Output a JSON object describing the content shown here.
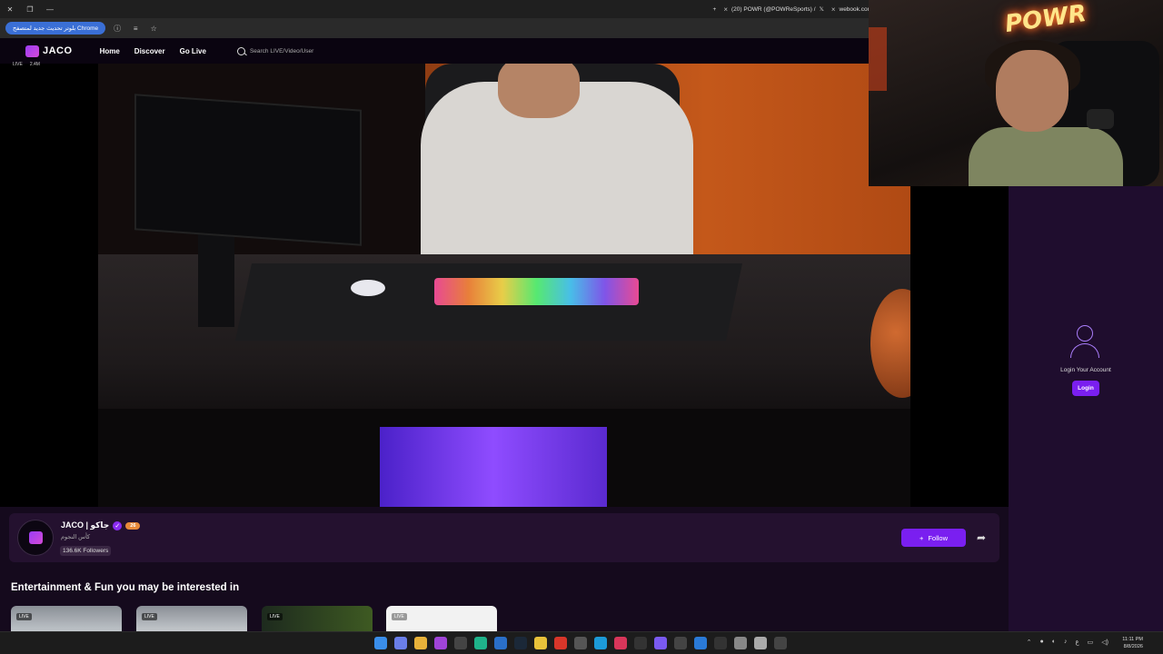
{
  "browser": {
    "update_pill": "بلوتر تحديث جديد لمتصفح Chrome",
    "tabs": [
      {
        "title": "(20) POWR (@POWReSports) /"
      },
      {
        "title": "webook.com"
      }
    ],
    "new_tab_label": "+",
    "close_label": "×",
    "x_logo": "𝕏"
  },
  "site": {
    "brand": "JACO",
    "nav": {
      "home": "Home",
      "discover": "Discover",
      "go_live": "Go Live"
    },
    "search_placeholder": "Search LIVE/Video/User"
  },
  "player": {
    "live_badge": "LIVE",
    "viewers": "2.4M"
  },
  "webcam": {
    "neon_sign": "POWR"
  },
  "sidebar": {
    "login_prompt": "Login Your Account",
    "login_button": "Login"
  },
  "channel": {
    "name": "JACO | جاكو",
    "verified_glyph": "✓",
    "level": "26",
    "category": "كأس النجوم",
    "followers": "136.6K Followers",
    "follow_label": "Follow",
    "follow_plus": "+",
    "share_glyph": "➦"
  },
  "recommendations": {
    "title": "Entertainment & Fun you may be interested in",
    "items": [
      {
        "live": "LIVE"
      },
      {
        "live": "LIVE"
      },
      {
        "live": "LIVE"
      },
      {
        "live": "LIVE"
      }
    ]
  },
  "taskbar": {
    "lang": "ع",
    "time": "11:11 PM",
    "date": "8/8/2026"
  }
}
